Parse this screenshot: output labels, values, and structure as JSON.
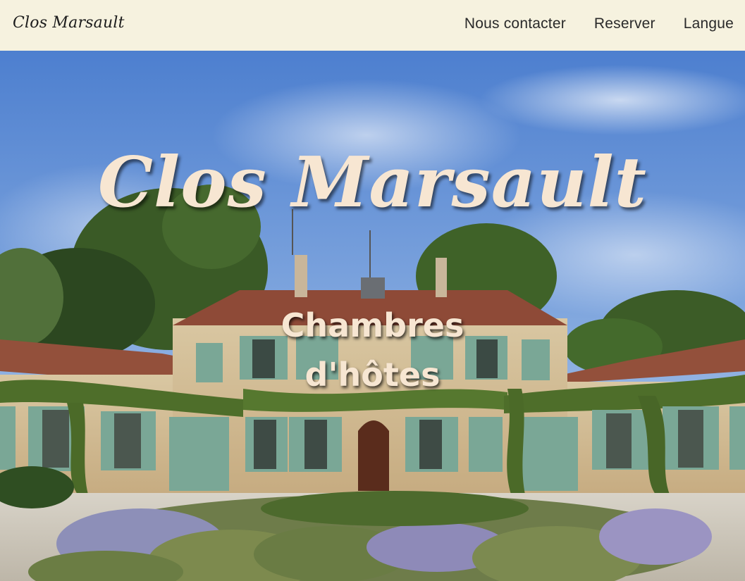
{
  "header": {
    "brand": "Clos Marsault",
    "nav": [
      {
        "label": "Nous contacter"
      },
      {
        "label": "Reserver"
      },
      {
        "label": "Langue"
      }
    ]
  },
  "hero": {
    "title": "Clos Marsault",
    "subtitle_line1": "Chambres",
    "subtitle_line2": "d'hôtes",
    "photo_subject": "stone manor house with green shutters, ivy, terracotta roof, lavender garden"
  },
  "colors": {
    "nav_background": "#f6f2df",
    "title_color": "#f7e6d2",
    "shutter_green": "#7aa796",
    "roof": "#8e4a37",
    "sky": "#4f82cf"
  }
}
